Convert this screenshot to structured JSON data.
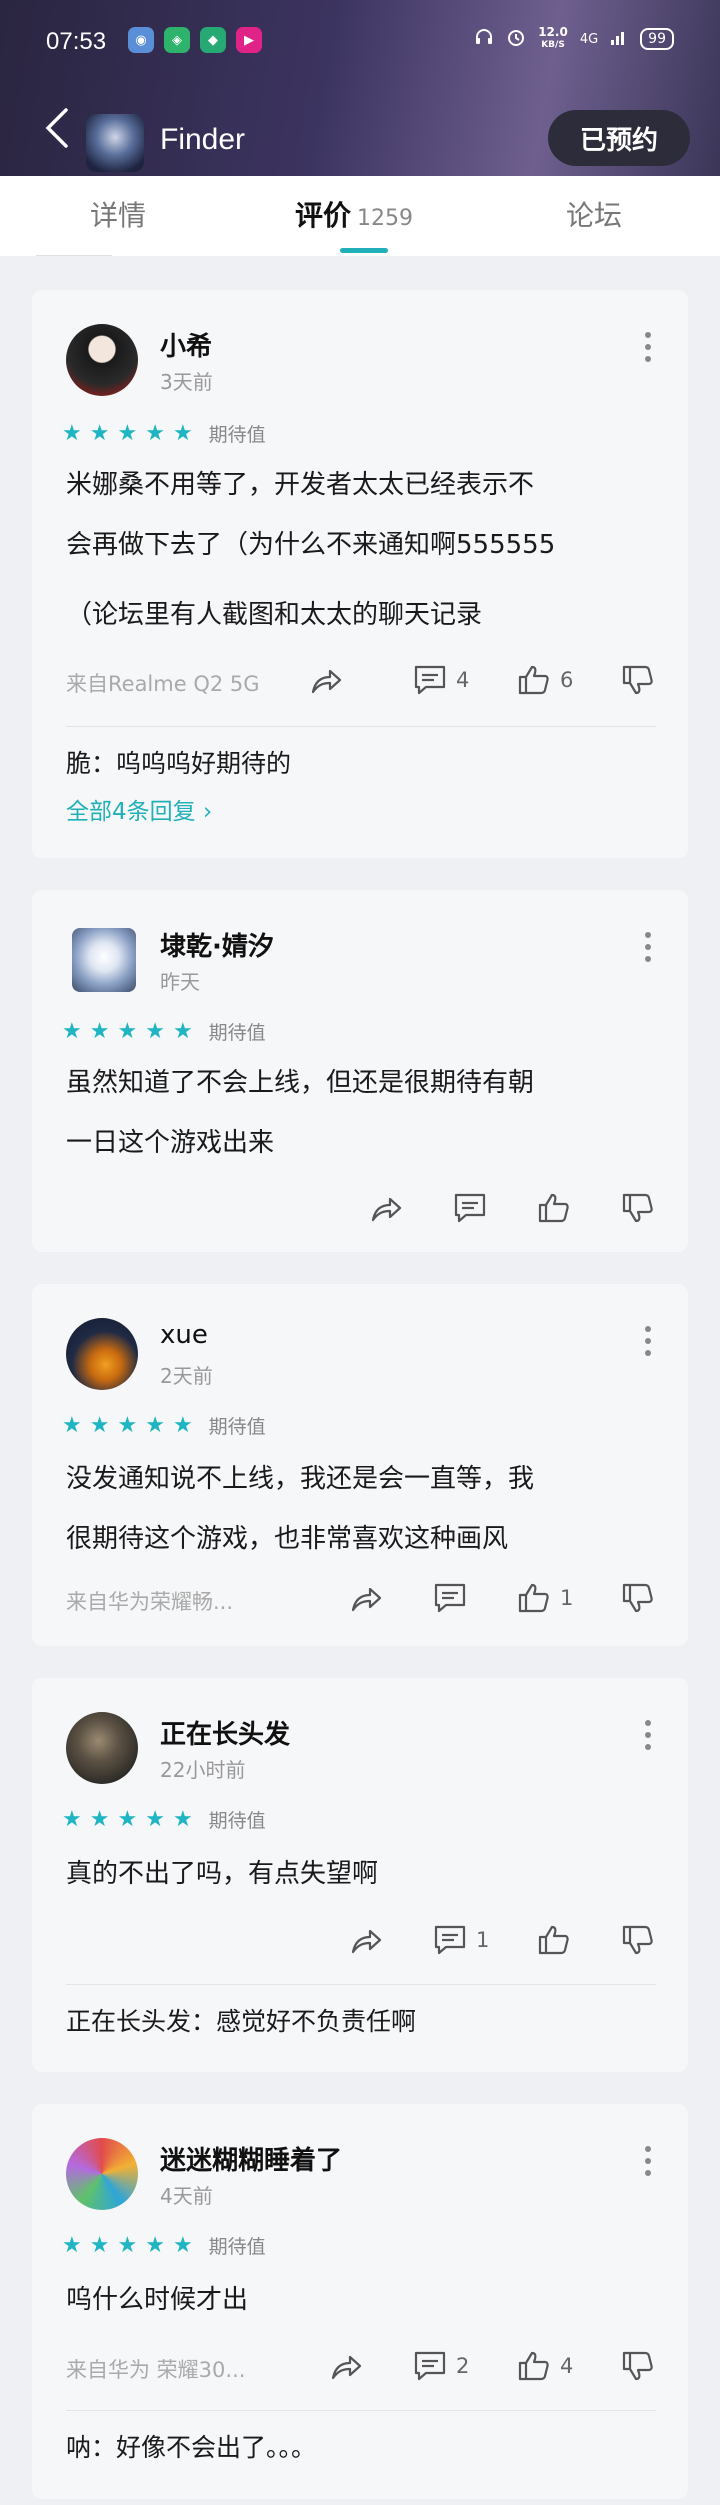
{
  "status_bar": {
    "time": "07:53",
    "speed_value": "12.0",
    "speed_unit": "KB/S",
    "network": "4G",
    "battery": "99"
  },
  "nav": {
    "app_name": "Finder",
    "reserve_label": "已预约"
  },
  "tabs": [
    {
      "label": "详情"
    },
    {
      "label": "评价",
      "count": "1259"
    },
    {
      "label": "论坛"
    }
  ],
  "rating_label": "期待值",
  "reviews": [
    {
      "user": "小希",
      "time": "3天前",
      "stars": 5,
      "lines": [
        "米娜桑不用等了，开发者太太已经表示不",
        "会再做下去了（为什么不来通知啊555555",
        "（论坛里有人截图和太太的聊天记录"
      ],
      "device": "来自Realme Q2 5G",
      "comments": "4",
      "likes": "6",
      "reply": "脆：呜呜呜好期待的",
      "all_replies": "全部4条回复"
    },
    {
      "user": "埭乾·婧汐",
      "time": "昨天",
      "stars": 5,
      "lines": [
        "虽然知道了不会上线，但还是很期待有朝",
        "一日这个游戏出来"
      ]
    },
    {
      "user": "xue",
      "time": "2天前",
      "stars": 5,
      "lines": [
        "没发通知说不上线，我还是会一直等，我",
        "很期待这个游戏，也非常喜欢这种画风"
      ],
      "device": "来自华为荣耀畅...",
      "likes": "1"
    },
    {
      "user": "正在长头发",
      "time": "22小时前",
      "stars": 5,
      "lines": [
        "真的不出了吗，有点失望啊"
      ],
      "comments": "1",
      "reply": "正在长头发：感觉好不负责任啊"
    },
    {
      "user": "迷迷糊糊睡着了",
      "time": "4天前",
      "stars": 5,
      "lines": [
        "呜什么时候才出"
      ],
      "device": "来自华为 荣耀30...",
      "comments": "2",
      "likes": "4",
      "reply": "呐：好像不会出了。。。"
    }
  ],
  "colors": {
    "accent": "#1fb5c2",
    "link": "#22b0b8",
    "card_bg": "#f6f7f9",
    "page_bg": "#eef0f3"
  }
}
